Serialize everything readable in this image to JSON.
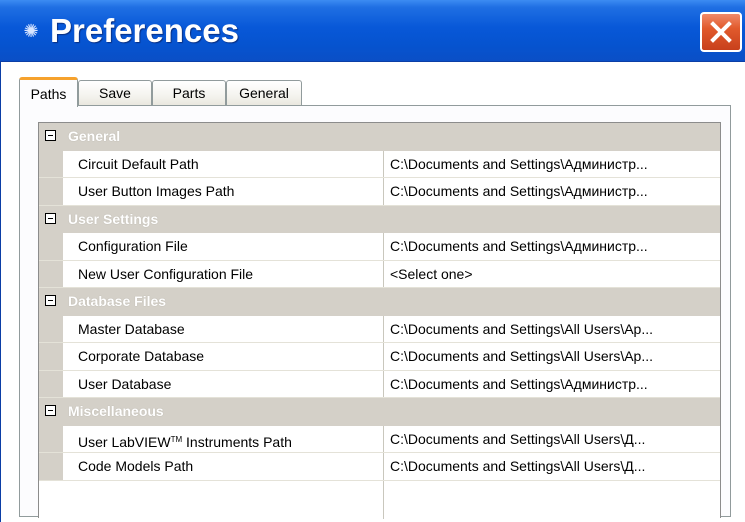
{
  "window": {
    "title": "Preferences",
    "icon": "preferences-app-icon",
    "close_icon": "close-icon",
    "colors": {
      "titlebar": "#0858d8",
      "close": "#e15a2c",
      "accent_tab": "#f6a22d",
      "category_bg": "#d4d0c8"
    }
  },
  "tabs": [
    {
      "label": "Paths",
      "active": true
    },
    {
      "label": "Save",
      "active": false
    },
    {
      "label": "Parts",
      "active": false
    },
    {
      "label": "General",
      "active": false
    }
  ],
  "categories": [
    {
      "label": "General",
      "rows": [
        {
          "name": "Circuit Default Path",
          "value": "C:\\Documents and Settings\\Администр..."
        },
        {
          "name": "User Button Images Path",
          "value": "C:\\Documents and Settings\\Администр..."
        }
      ]
    },
    {
      "label": "User Settings",
      "rows": [
        {
          "name": "Configuration File",
          "value": "C:\\Documents and Settings\\Администр..."
        },
        {
          "name": "New User Configuration File",
          "value": "<Select one>"
        }
      ]
    },
    {
      "label": "Database Files",
      "rows": [
        {
          "name": "Master Database",
          "value": "C:\\Documents and Settings\\All Users\\Ap..."
        },
        {
          "name": "Corporate Database",
          "value": "C:\\Documents and Settings\\All Users\\Ap..."
        },
        {
          "name": "User Database",
          "value": "C:\\Documents and Settings\\Администр..."
        }
      ]
    },
    {
      "label": "Miscellaneous",
      "rows": [
        {
          "name_prefix": "User LabVIEW",
          "name_tm": "TM",
          "name_suffix": " Instruments Path",
          "value": "C:\\Documents and Settings\\All Users\\Д..."
        },
        {
          "name": "Code Models Path",
          "value": "C:\\Documents and Settings\\All Users\\Д..."
        }
      ]
    }
  ]
}
